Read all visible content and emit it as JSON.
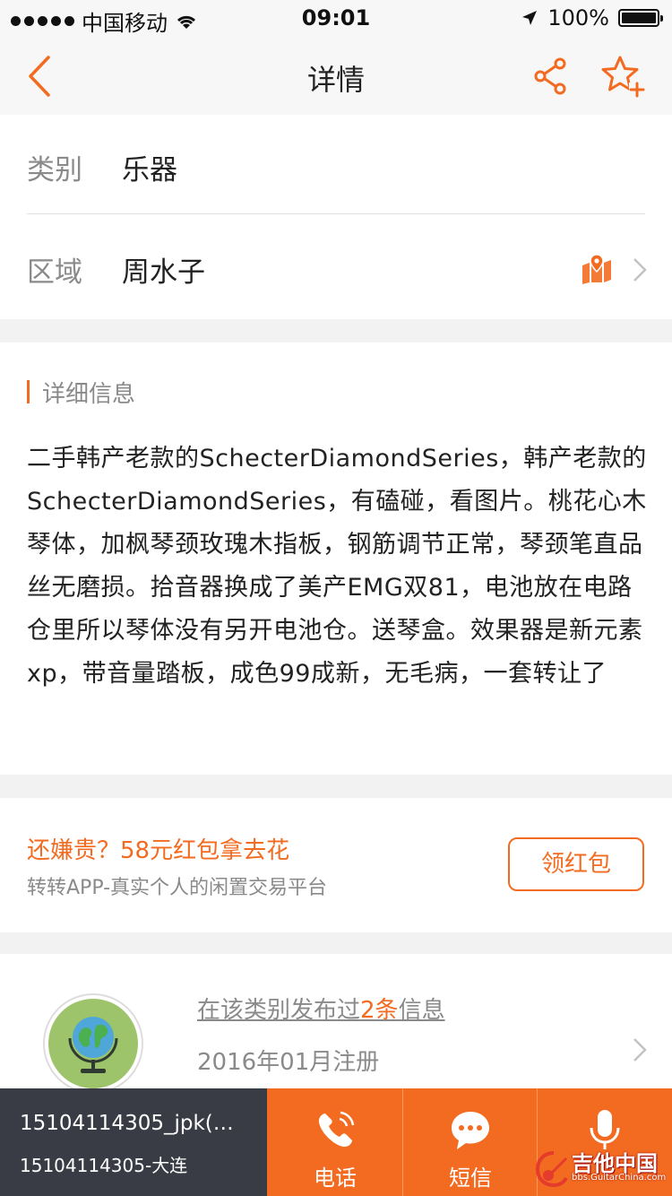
{
  "status_bar": {
    "carrier": "中国移动",
    "time": "09:01",
    "battery": "100%"
  },
  "nav": {
    "title": "详情"
  },
  "info": {
    "category_label": "类别",
    "category_value": "乐器",
    "area_label": "区域",
    "area_value": "周水子"
  },
  "detail": {
    "section_title": "详细信息",
    "description": "二手韩产老款的SchecterDiamondSeries，韩产老款的SchecterDiamondSeries，有磕碰，看图片。桃花心木琴体，加枫琴颈玫瑰木指板，钢筋调节正常，琴颈笔直品丝无磨损。拾音器换成了美产EMG双81，电池放在电路仓里所以琴体没有另开电池仓。送琴盒。效果器是新元素xp，带音量踏板，成色99成新，无毛病，一套转让了"
  },
  "promo": {
    "title": "还嫌贵？58元红包拿去花",
    "subtitle": "转转APP-真实个人的闲置交易平台",
    "button": "领红包"
  },
  "seller": {
    "posted_prefix": "在该类别发布过",
    "posted_count": "2条",
    "posted_suffix": "信息",
    "registered": "2016年01月注册"
  },
  "bottom_bar": {
    "contact_name": "15104114305_jpk(…",
    "contact_sub": "15104114305-大连",
    "phone_label": "电话",
    "sms_label": "短信"
  },
  "watermark": {
    "name": "吉他中国",
    "url": "bbs.GuitarChina.com"
  },
  "colors": {
    "accent": "#f26b21",
    "dark_bar": "#3a3c45",
    "background": "#f2f2f2"
  }
}
